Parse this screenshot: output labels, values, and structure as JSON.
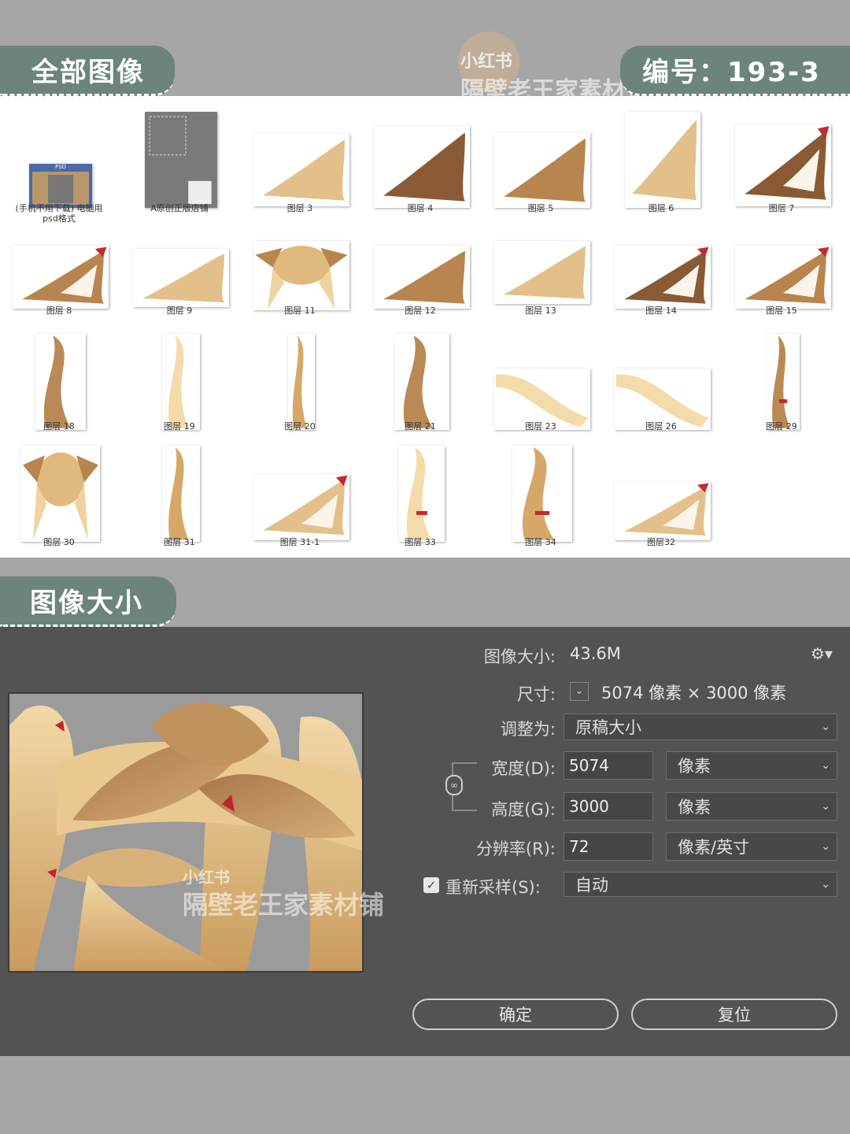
{
  "header": {
    "all_images_tag": "全部图像",
    "code_tag": "编号：193-3",
    "watermark_small": "小红书",
    "watermark_shop": "隔壁老王家素材铺"
  },
  "layers": [
    {
      "label": "(手机不用下载) 电脑用\npsd格式"
    },
    {
      "label": "A原创正版店铺"
    },
    {
      "label": "图层 3"
    },
    {
      "label": "图层 4"
    },
    {
      "label": "图层 5"
    },
    {
      "label": "图层 6"
    },
    {
      "label": "图层 7"
    },
    {
      "label": "图层 8"
    },
    {
      "label": "图层 9"
    },
    {
      "label": "图层 11"
    },
    {
      "label": "图层 12"
    },
    {
      "label": "图层 13"
    },
    {
      "label": "图层 14"
    },
    {
      "label": "图层 15"
    },
    {
      "label": "图层 18"
    },
    {
      "label": "图层 19"
    },
    {
      "label": "图层 20"
    },
    {
      "label": "图层 21"
    },
    {
      "label": "图层 23"
    },
    {
      "label": "图层 26"
    },
    {
      "label": "图层 29"
    },
    {
      "label": "图层 30"
    },
    {
      "label": "图层 31"
    },
    {
      "label": "图层 31-1"
    },
    {
      "label": "图层 33"
    },
    {
      "label": "图层 34"
    },
    {
      "label": "图层32"
    }
  ],
  "psd_badge": "PSD",
  "size_tag": "图像大小",
  "dialog": {
    "image_size_label": "图像大小:",
    "image_size_value": "43.6M",
    "dimensions_label": "尺寸:",
    "dimensions_value": "5074 像素  ×  3000 像素",
    "fit_to_label": "调整为:",
    "fit_to_value": "原稿大小",
    "width_label": "宽度(D):",
    "width_value": "5074",
    "width_unit": "像素",
    "height_label": "高度(G):",
    "height_value": "3000",
    "height_unit": "像素",
    "resolution_label": "分辨率(R):",
    "resolution_value": "72",
    "resolution_unit": "像素/英寸",
    "resample_label": "重新采样(S):",
    "resample_value": "自动",
    "ok_button": "确定",
    "reset_button": "复位"
  }
}
